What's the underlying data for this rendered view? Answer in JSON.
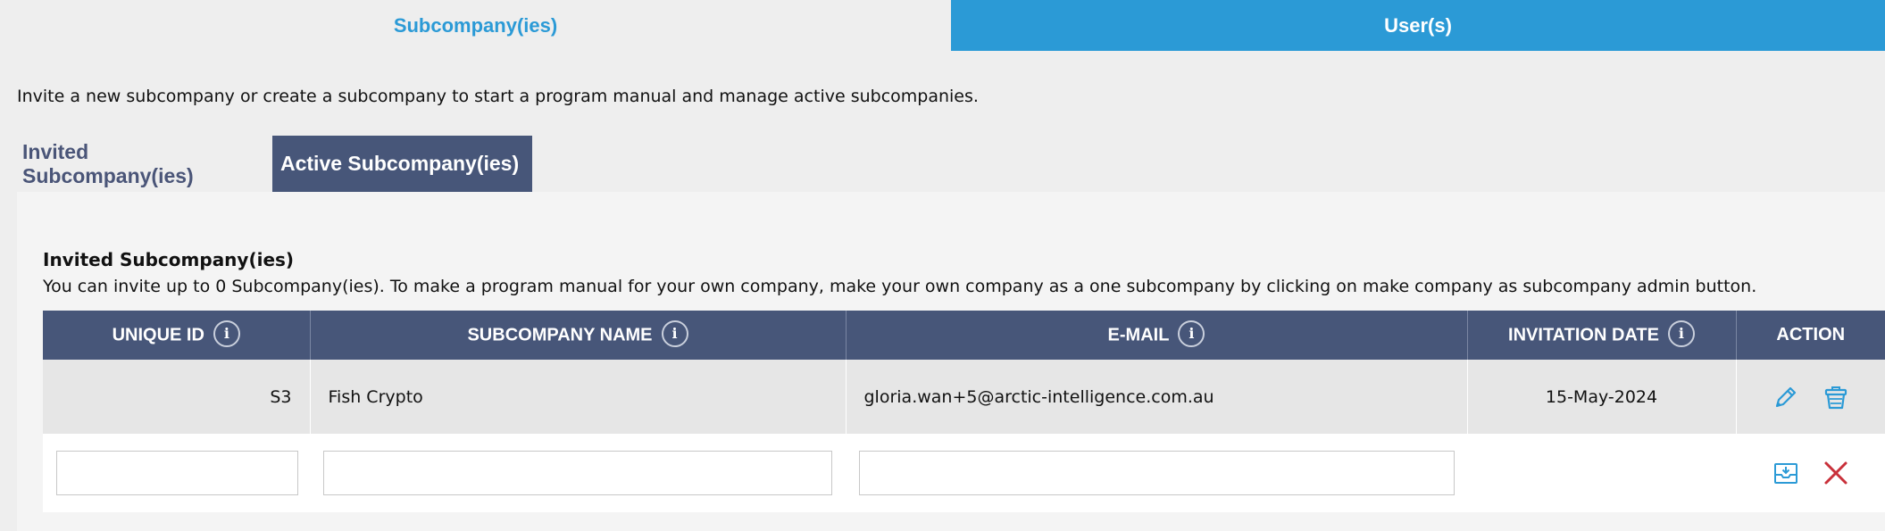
{
  "top_tabs": [
    {
      "label": "Subcompany(ies)",
      "active": true
    },
    {
      "label": "User(s)",
      "active": false
    }
  ],
  "intro_text": "Invite a new subcompany or create a subcompany to start a program manual and manage active subcompanies.",
  "sub_tabs": {
    "invited": "Invited Subcompany(ies)",
    "active": "Active Subcompany(ies)"
  },
  "section": {
    "title": "Invited Subcompany(ies)",
    "description": "You can invite up to 0 Subcompany(ies). To make a program manual for your own company, make your own company as a one subcompany by clicking on make company as subcompany admin button."
  },
  "table": {
    "columns": {
      "unique_id": "UNIQUE ID",
      "name": "SUBCOMPANY NAME",
      "email": "E-MAIL",
      "date": "INVITATION DATE",
      "action": "ACTION"
    },
    "info_glyph": "i",
    "rows": [
      {
        "unique_id": "S3",
        "name": "Fish Crypto",
        "email": "gloria.wan+5@arctic-intelligence.com.au",
        "date": "15-May-2024"
      }
    ],
    "new_row": {
      "unique_id_value": "",
      "name_value": "",
      "email_value": ""
    }
  },
  "icons": {
    "edit": "pencil-icon",
    "delete": "trash-icon",
    "save": "save-inbox-icon",
    "cancel": "close-icon"
  },
  "colors": {
    "accent_blue": "#2b9ad6",
    "header_navy": "#475679",
    "delete_red": "#c9303a"
  }
}
